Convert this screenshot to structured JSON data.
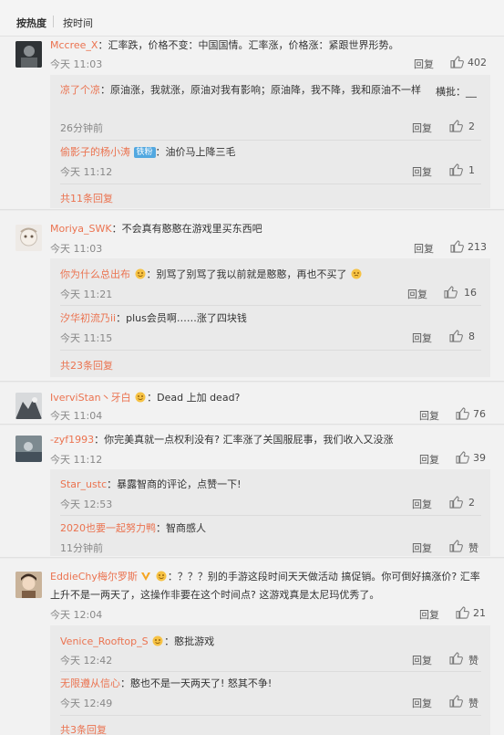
{
  "sort": {
    "hot": "按热度",
    "time": "按时间"
  },
  "colors": {
    "username": "#eb7350",
    "fans_badge": "#52a8e0",
    "vip": "#f5a623"
  },
  "icons": {
    "like": "thumb-up-icon",
    "emoji": "emoji-icon",
    "vip": "vip-v-icon"
  },
  "comments": [
    {
      "user": "Mccree_X",
      "text": "：汇率跌，价格不变：中国国情。汇率涨，价格涨：紧跟世界形势。",
      "time": "今天 11:03",
      "reply": "回复",
      "likes": "402",
      "replies": [
        {
          "user": "凉了个凉",
          "text": "：原油涨，我就涨，原油对我有影响；原油降，我不降，我和原油不一样",
          "extra": "横批：______",
          "time": "26分钟前",
          "reply": "回复",
          "likes": "2"
        },
        {
          "user": "偷影子的杨小涛",
          "badge": "铁粉",
          "text": "：油价马上降三毛",
          "time": "今天 11:12",
          "reply": "回复",
          "likes": "1"
        }
      ],
      "more": "共11条回复"
    },
    {
      "user": "Moriya_SWK",
      "text": "：不会真有憨憨在游戏里买东西吧",
      "time": "今天 11:03",
      "reply": "回复",
      "likes": "213",
      "replies": [
        {
          "user": "你为什么总出布",
          "text": "：别骂了别骂了我以前就是憨憨，再也不买了",
          "time": "今天 11:21",
          "reply": "回复",
          "likes": "16"
        },
        {
          "user": "汐华初流乃ii",
          "text": "：plus会员啊……涨了四块钱",
          "time": "今天 11:15",
          "reply": "回复",
          "likes": "8"
        }
      ],
      "more": "共23条回复"
    },
    {
      "user": "IverviStan丶牙白",
      "text": "：Dead 上加 dead?",
      "time": "今天 11:04",
      "reply": "回复",
      "likes": "76"
    },
    {
      "user": "-zyf1993",
      "text": "：你完美真就一点权利没有? 汇率涨了关国服屁事，我们收入又没涨",
      "time": "今天 11:12",
      "reply": "回复",
      "likes": "39",
      "replies": [
        {
          "user": "Star_ustc",
          "text": "：暴露智商的评论，点赞一下!",
          "time": "今天 12:53",
          "reply": "回复",
          "likes": "2"
        },
        {
          "user": "2020也要一起努力鸭",
          "text": "：智商感人",
          "time": "11分钟前",
          "reply": "回复",
          "likes": "赞"
        }
      ]
    },
    {
      "user": "EddieChy梅尔罗斯",
      "text": "：？？？别的手游这段时间天天做活动 搞促销。你可倒好搞涨价? 汇率",
      "text2": "上升不是一两天了，这操作非要在这个时间点? 这游戏真是太尼玛优秀了。",
      "time": "今天 12:04",
      "reply": "回复",
      "likes": "21",
      "replies": [
        {
          "user": "Venice_Rooftop_S",
          "text": "：憨批游戏",
          "time": "今天 12:42",
          "reply": "回复",
          "likes": "赞"
        },
        {
          "user": "无限遵从信心",
          "text": "：憨也不是一天两天了! 怒其不争!",
          "time": "今天 12:49",
          "reply": "回复",
          "likes": "赞"
        }
      ],
      "more": "共3条回复"
    }
  ]
}
